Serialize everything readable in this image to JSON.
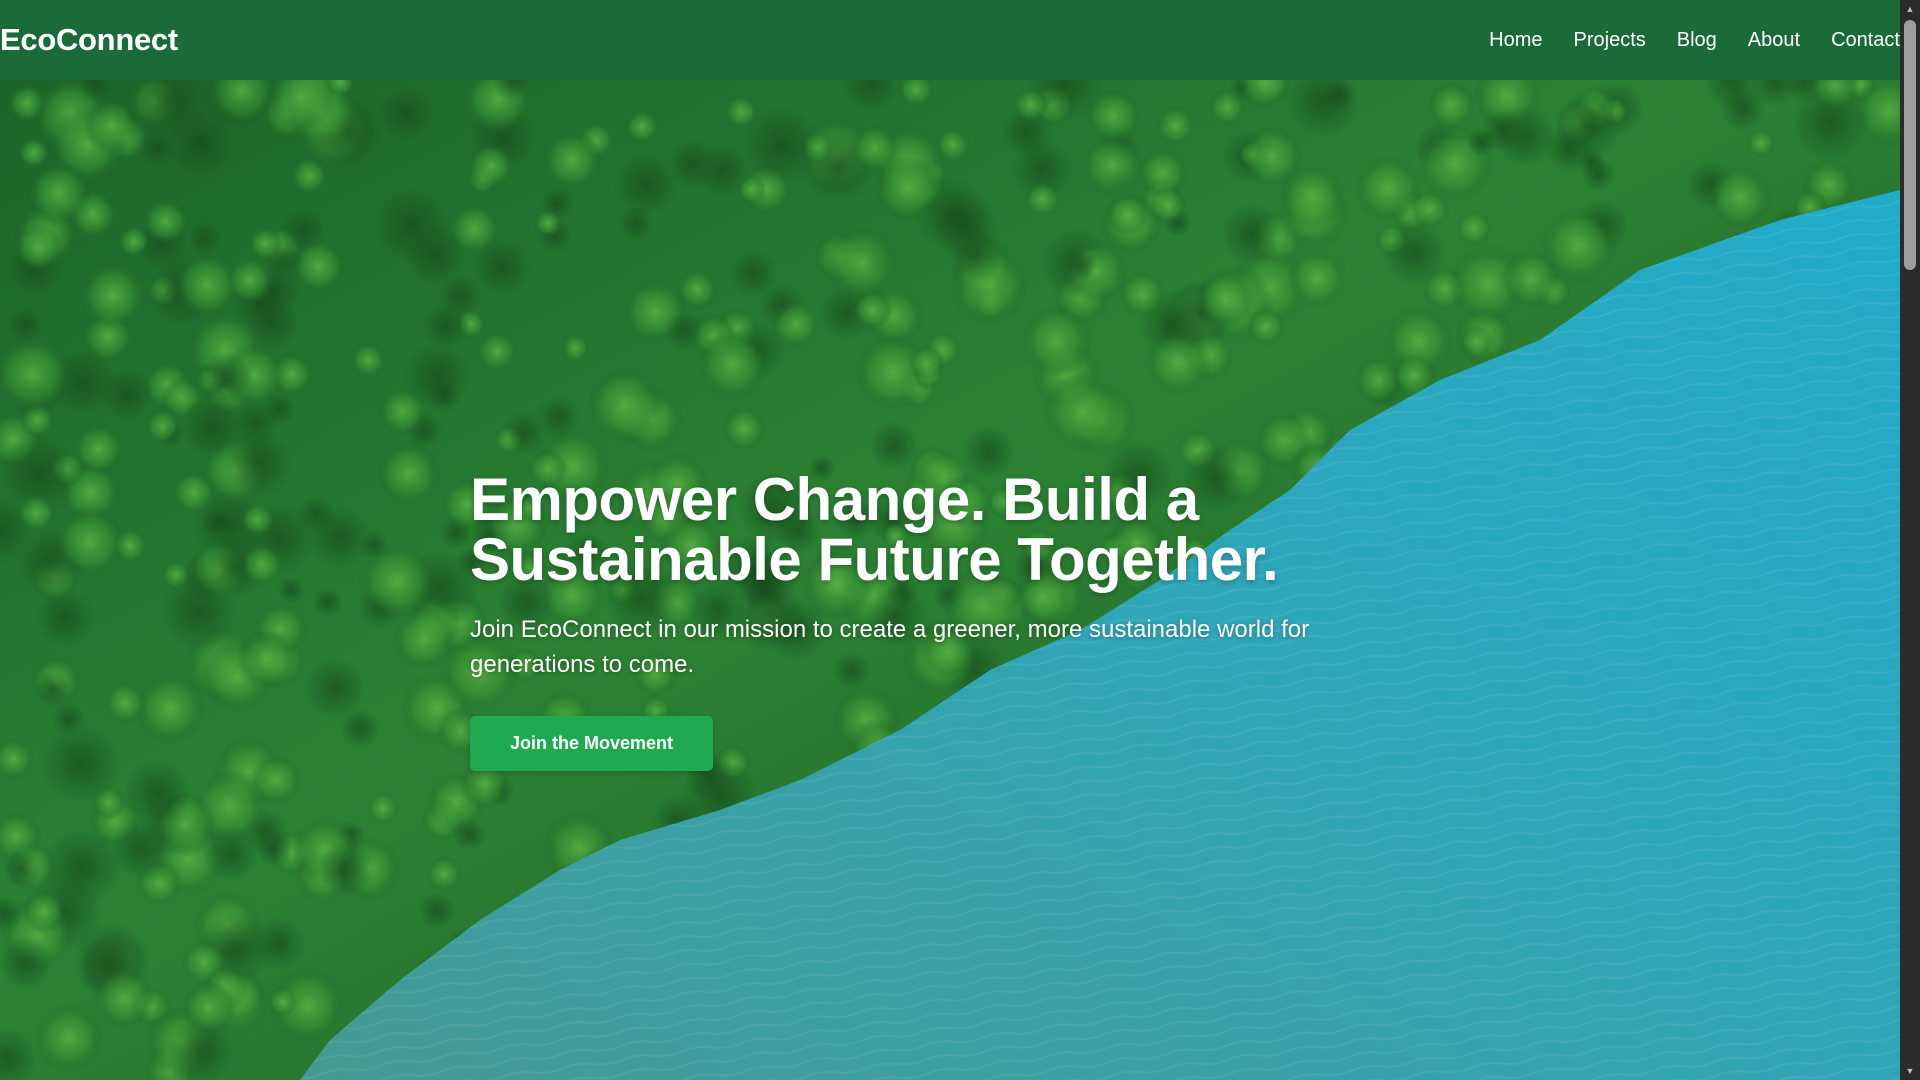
{
  "header": {
    "logo": "EcoConnect",
    "nav": [
      {
        "label": "Home"
      },
      {
        "label": "Projects"
      },
      {
        "label": "Blog"
      },
      {
        "label": "About"
      },
      {
        "label": "Contact"
      }
    ]
  },
  "hero": {
    "title": "Empower Change. Build a Sustainable Future Together.",
    "subtitle": "Join EcoConnect in our mission to create a greener, more sustainable world for generations to come.",
    "cta_label": "Join the Movement",
    "background": "aerial-forest-lake-photo"
  },
  "colors": {
    "header_bg": "#1a6b37",
    "cta_bg": "#1faa4f",
    "forest": "#2e7d32",
    "water": "#2bb3c9"
  },
  "icons": {
    "scroll_up": "▲",
    "scroll_down": "▼"
  }
}
